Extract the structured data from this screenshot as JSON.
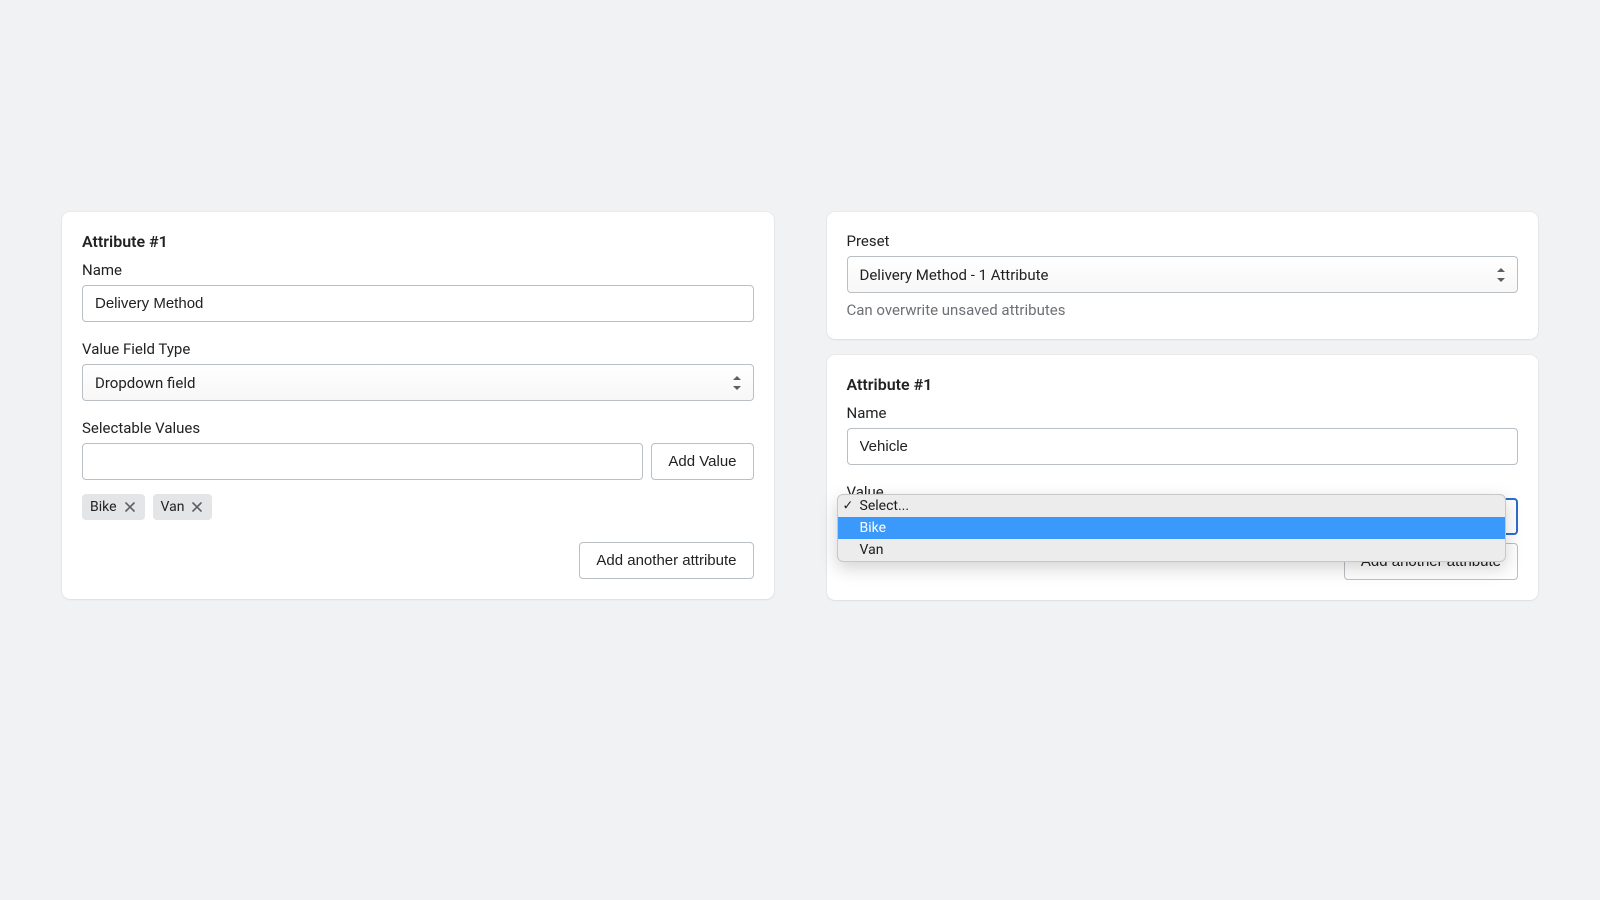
{
  "left": {
    "attribute": {
      "title": "Attribute #1",
      "name_label": "Name",
      "name_value": "Delivery Method",
      "value_field_type_label": "Value Field Type",
      "value_field_type_value": "Dropdown field",
      "selectable_values_label": "Selectable Values",
      "selectable_values_input": "",
      "add_value_label": "Add Value",
      "tags": [
        "Bike",
        "Van"
      ],
      "add_another_label": "Add another attribute"
    }
  },
  "right": {
    "preset": {
      "label": "Preset",
      "value": "Delivery Method - 1 Attribute",
      "helper": "Can overwrite unsaved attributes"
    },
    "attribute": {
      "title": "Attribute #1",
      "name_label": "Name",
      "name_value": "Vehicle",
      "value_label": "Value",
      "dropdown_placeholder": "Select...",
      "dropdown_options": [
        "Bike",
        "Van"
      ],
      "dropdown_highlighted_index": 0,
      "add_another_label": "Add another attribute"
    }
  }
}
